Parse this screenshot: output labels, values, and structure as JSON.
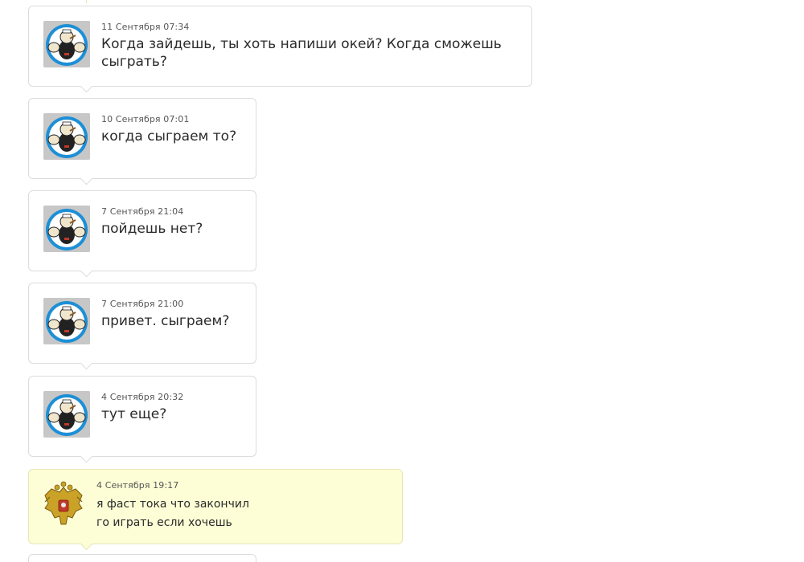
{
  "messages": [
    {
      "author_avatar": "popeye-icon",
      "timestamp": "11 Сентября 07:34",
      "lines": [
        "Когда зайдешь, ты хоть напиши окей? Когда сможешь",
        "сыграть?"
      ]
    },
    {
      "author_avatar": "popeye-icon",
      "timestamp": "10 Сентября 07:01",
      "lines": [
        "когда сыграем то?"
      ]
    },
    {
      "author_avatar": "popeye-icon",
      "timestamp": "7 Сентября 21:04",
      "lines": [
        "пойдешь нет?"
      ]
    },
    {
      "author_avatar": "popeye-icon",
      "timestamp": "7 Сентября 21:00",
      "lines": [
        "привет. сыграем?"
      ]
    },
    {
      "author_avatar": "popeye-icon",
      "timestamp": "4 Сентября 20:32",
      "lines": [
        "тут еще?"
      ]
    },
    {
      "author_avatar": "russian-coat-of-arms-icon",
      "timestamp": "4 Сентября 19:17",
      "lines": [
        "я фаст тока что закончил",
        "го играть если хочешь"
      ]
    }
  ],
  "colors": {
    "own_message_bg": "#fdfdd6",
    "other_message_bg": "#ffffff",
    "border": "#dcdcdc"
  }
}
